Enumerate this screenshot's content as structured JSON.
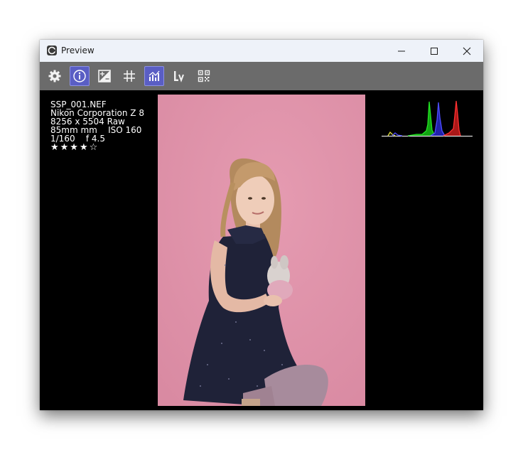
{
  "window": {
    "title": "Preview"
  },
  "toolbar": {
    "buttons": [
      {
        "icon": "gear-icon",
        "active": false
      },
      {
        "icon": "info-icon",
        "active": true
      },
      {
        "icon": "exposure-icon",
        "active": false
      },
      {
        "icon": "grid-icon",
        "active": false
      },
      {
        "icon": "histogram-icon",
        "active": true
      },
      {
        "icon": "lv-icon",
        "active": false
      },
      {
        "icon": "qr-code-icon",
        "active": false
      }
    ]
  },
  "info": {
    "filename": "SSP_001.NEF",
    "camera": "Nikon Corporation Z 8",
    "dimensions": "8256 x 5504 Raw",
    "focal_iso": "85mm mm    ISO 160",
    "shutter_aperture": "1/160    f 4.5",
    "rating": "★★★★☆"
  },
  "colors": {
    "titlebar_bg": "#eef2f9",
    "toolbar_bg": "#6b6b6b",
    "active_button": "#5a5ec4",
    "photo_backdrop": "#df94ab"
  }
}
